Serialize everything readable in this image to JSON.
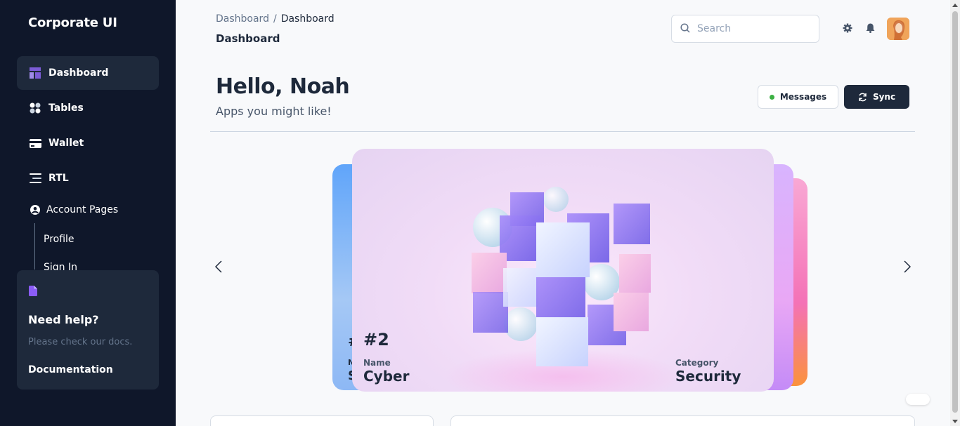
{
  "sidebar": {
    "brand": "Corporate UI",
    "items": [
      {
        "label": "Dashboard",
        "icon": "dashboard-icon",
        "active": true
      },
      {
        "label": "Tables",
        "icon": "tables-icon"
      },
      {
        "label": "Wallet",
        "icon": "wallet-icon"
      },
      {
        "label": "RTL",
        "icon": "rtl-icon"
      }
    ],
    "account_pages": {
      "label": "Account Pages",
      "sub_items": [
        "Profile",
        "Sign In"
      ]
    },
    "help": {
      "title": "Need help?",
      "subtitle": "Please check our docs.",
      "link": "Documentation"
    }
  },
  "header": {
    "breadcrumb": [
      "Dashboard",
      "Dashboard"
    ],
    "separator": "/",
    "title": "Dashboard",
    "search_placeholder": "Search"
  },
  "main": {
    "greeting": "Hello, Noah",
    "subtitle": "Apps you might like!",
    "messages_button": "Messages",
    "sync_button": "Sync",
    "status_color": "#3cb043"
  },
  "carousel": {
    "active_card": {
      "rank": "#2",
      "name_label": "Name",
      "name": "Cyber",
      "category_label": "Category",
      "category": "Security"
    }
  },
  "colors": {
    "sidebar_bg": "#0f172a",
    "sidebar_active": "#1e293b",
    "accent": "#7c5cd6",
    "primary_button": "#1e293b"
  }
}
